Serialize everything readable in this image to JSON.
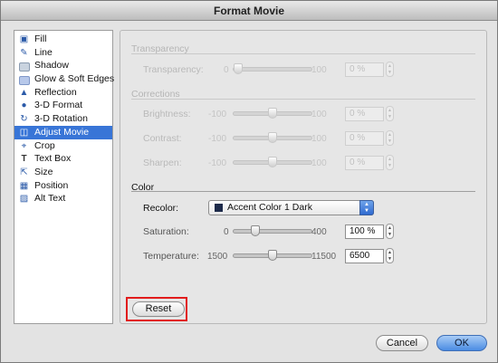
{
  "window": {
    "title": "Format Movie"
  },
  "sidebar": {
    "items": [
      {
        "label": "Fill",
        "icon": "paint-bucket-icon"
      },
      {
        "label": "Line",
        "icon": "pencil-line-icon"
      },
      {
        "label": "Shadow",
        "icon": "shadow-icon"
      },
      {
        "label": "Glow & Soft Edges",
        "icon": "glow-icon"
      },
      {
        "label": "Reflection",
        "icon": "reflection-icon"
      },
      {
        "label": "3-D Format",
        "icon": "3d-format-icon"
      },
      {
        "label": "3-D Rotation",
        "icon": "3d-rotation-icon"
      },
      {
        "label": "Adjust Movie",
        "icon": "film-icon"
      },
      {
        "label": "Crop",
        "icon": "crop-icon"
      },
      {
        "label": "Text Box",
        "icon": "text-box-icon"
      },
      {
        "label": "Size",
        "icon": "size-icon"
      },
      {
        "label": "Position",
        "icon": "position-icon"
      },
      {
        "label": "Alt Text",
        "icon": "alt-text-icon"
      }
    ],
    "selected": "Adjust Movie"
  },
  "transparency": {
    "heading": "Transparency",
    "label": "Transparency:",
    "min": "0",
    "max": "100",
    "value": "0 %",
    "slider_level": 0
  },
  "corrections": {
    "heading": "Corrections",
    "brightness": {
      "label": "Brightness:",
      "min": "-100",
      "max": "100",
      "value": "0 %",
      "slider_level": 0.5
    },
    "contrast": {
      "label": "Contrast:",
      "min": "-100",
      "max": "100",
      "value": "0 %",
      "slider_level": 0.5
    },
    "sharpen": {
      "label": "Sharpen:",
      "min": "-100",
      "max": "100",
      "value": "0 %",
      "slider_level": 0.5
    }
  },
  "color": {
    "heading": "Color",
    "recolor_label": "Recolor:",
    "recolor_value": "Accent Color 1 Dark",
    "recolor_swatch": "#1d2a4a",
    "saturation": {
      "label": "Saturation:",
      "min": "0",
      "max": "400",
      "value": "100 %",
      "slider_level": 0.25
    },
    "temperature": {
      "label": "Temperature:",
      "min": "1500",
      "max": "11500",
      "value": "6500",
      "slider_level": 0.5
    }
  },
  "buttons": {
    "reset": "Reset",
    "cancel": "Cancel",
    "ok": "OK"
  },
  "colors": {
    "selection": "#3875d7",
    "highlight_box": "#e11c1c",
    "default_button": "#4a8ce3"
  }
}
